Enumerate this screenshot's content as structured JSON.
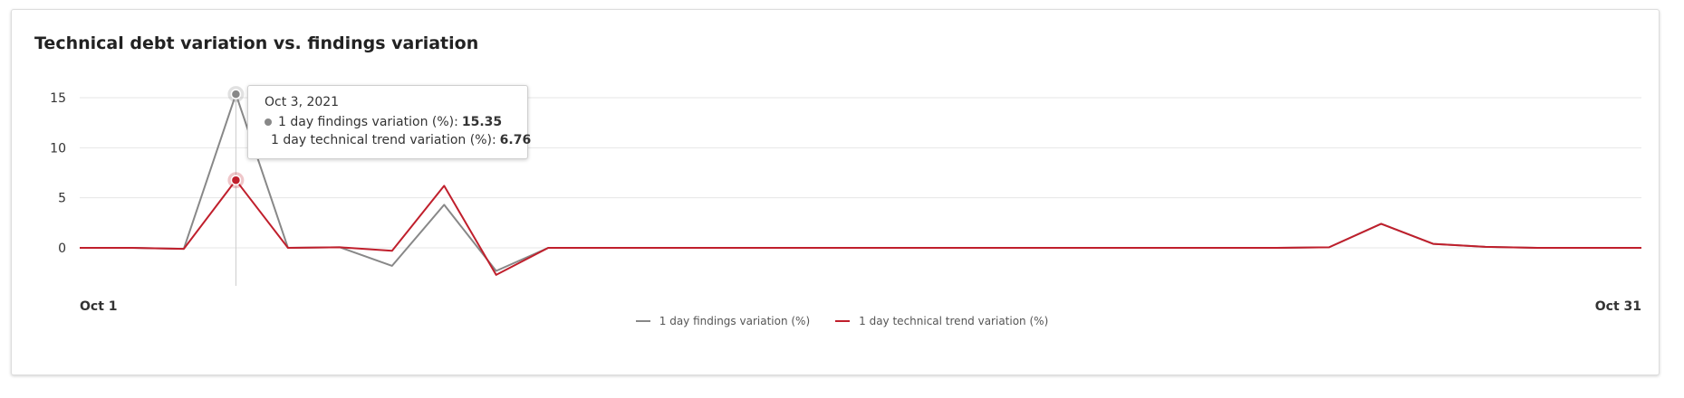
{
  "title": "Technical debt variation vs. findings variation",
  "tooltip": {
    "date": "Oct 3, 2021",
    "rows": [
      {
        "label": "1 day findings variation (%):",
        "value": "15.35",
        "color": "#888888"
      },
      {
        "label": "1 day technical trend variation (%):",
        "value": "6.76",
        "color": "#c01f2c"
      }
    ]
  },
  "colors": {
    "findings": "#888888",
    "technical": "#c01f2c",
    "grid": "#e6e6e6"
  },
  "chart_data": {
    "type": "line",
    "title": "Technical debt variation vs. findings variation",
    "x_tick_labels": [
      "Oct 1",
      "Oct 31"
    ],
    "x": [
      1,
      2,
      3,
      4,
      5,
      6,
      7,
      8,
      9,
      10,
      11,
      12,
      13,
      14,
      15,
      16,
      17,
      18,
      19,
      20,
      21,
      22,
      23,
      24,
      25,
      26,
      27,
      28,
      29,
      30,
      31
    ],
    "y_ticks": [
      0,
      5,
      10,
      15
    ],
    "ylim": [
      -4,
      16.5
    ],
    "grid": true,
    "legend_position": "bottom-center",
    "series": [
      {
        "name": "1 day findings variation (%)",
        "color": "#888888",
        "values": [
          0,
          0,
          -0.1,
          15.35,
          0,
          0.05,
          -1.8,
          4.3,
          -2.3,
          0,
          0,
          0,
          0,
          0,
          0,
          0,
          0,
          0,
          0,
          0,
          0,
          0,
          0,
          0,
          0.05,
          2.4,
          0.4,
          0.1,
          0,
          0,
          0
        ]
      },
      {
        "name": "1 day technical trend variation (%)",
        "color": "#c01f2c",
        "values": [
          0,
          0,
          -0.1,
          6.76,
          0,
          0.05,
          -0.3,
          6.2,
          -2.7,
          0,
          0,
          0,
          0,
          0,
          0,
          0,
          0,
          0,
          0,
          0,
          0,
          0,
          0,
          0,
          0.05,
          2.4,
          0.4,
          0.1,
          0,
          0,
          0
        ]
      }
    ],
    "highlight_x": 4
  }
}
